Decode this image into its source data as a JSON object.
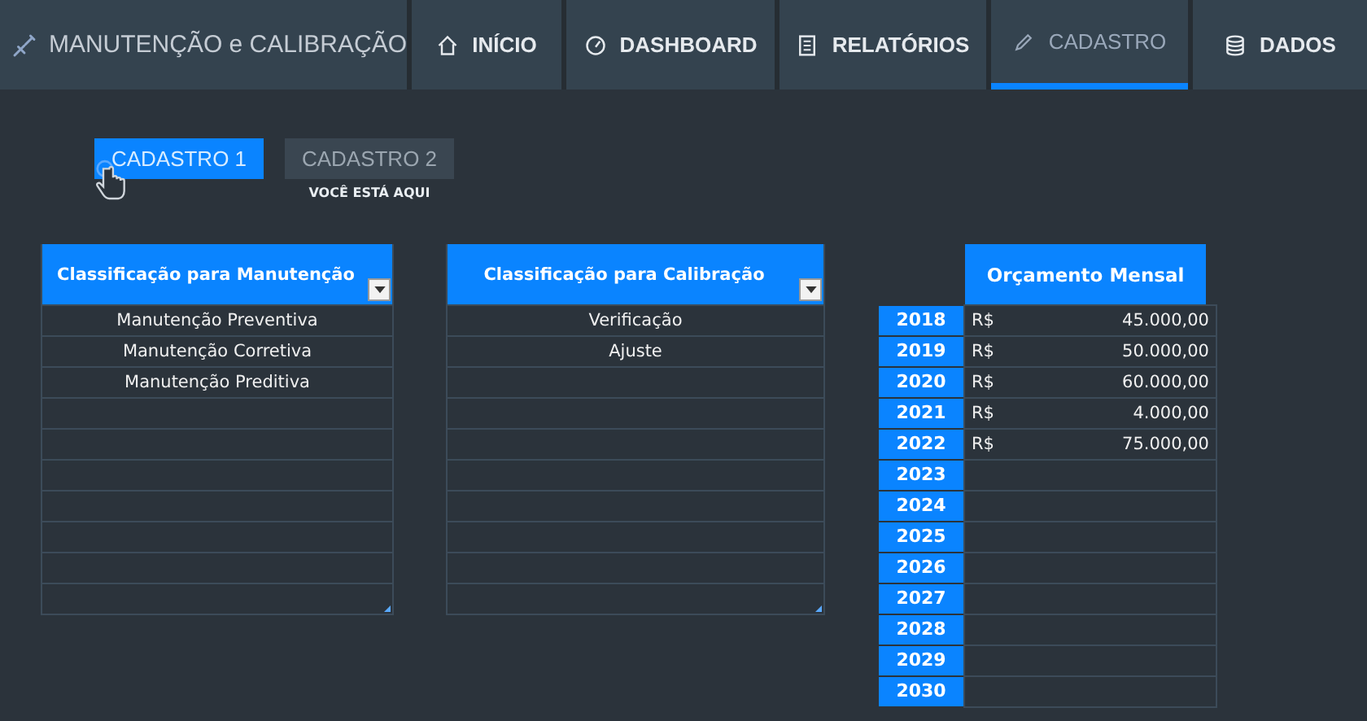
{
  "app_title": "MANUTENÇÃO e CALIBRAÇÃO",
  "nav": [
    {
      "label": "INÍCIO",
      "selected": false
    },
    {
      "label": "DASHBOARD",
      "selected": false
    },
    {
      "label": "RELATÓRIOS",
      "selected": false
    },
    {
      "label": "CADASTRO",
      "selected": true
    },
    {
      "label": "DADOS",
      "selected": false
    }
  ],
  "subtabs": [
    {
      "label": "CADASTRO 1",
      "selected": true
    },
    {
      "label": "CADASTRO 2",
      "selected": false
    }
  ],
  "here_note": "VOCÊ ESTÁ AQUI",
  "lists": [
    {
      "title": "Classificação para Manutenção",
      "items": [
        "Manutenção Preventiva",
        "Manutenção Corretiva",
        "Manutenção Preditiva"
      ]
    },
    {
      "title": "Classificação para Calibração",
      "items": [
        "Verificação",
        "Ajuste"
      ]
    }
  ],
  "budget": {
    "title": "Orçamento Mensal",
    "rows": [
      {
        "year": "2018",
        "currency": "R$",
        "amount": "45.000,00"
      },
      {
        "year": "2019",
        "currency": "R$",
        "amount": "50.000,00"
      },
      {
        "year": "2020",
        "currency": "R$",
        "amount": "60.000,00"
      },
      {
        "year": "2021",
        "currency": "R$",
        "amount": "4.000,00"
      },
      {
        "year": "2022",
        "currency": "R$",
        "amount": "75.000,00"
      },
      {
        "year": "2023"
      },
      {
        "year": "2024"
      },
      {
        "year": "2025"
      },
      {
        "year": "2026"
      },
      {
        "year": "2027"
      },
      {
        "year": "2028"
      },
      {
        "year": "2029"
      },
      {
        "year": "2030"
      }
    ]
  }
}
